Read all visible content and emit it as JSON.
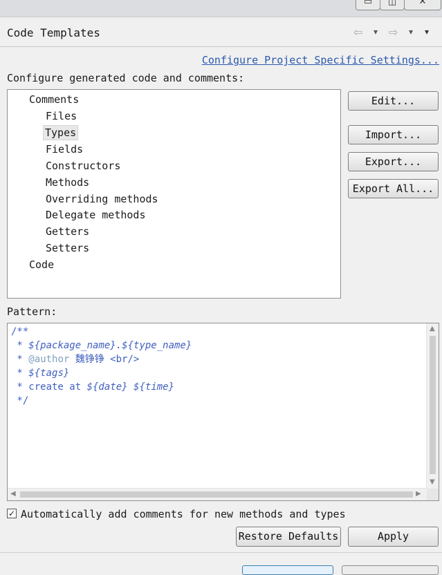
{
  "window": {
    "minimize": "▭",
    "maximize": "◫",
    "close": "✕"
  },
  "header": {
    "title": "Code Templates",
    "back_icon": "arrow-left-icon",
    "forward_icon": "arrow-right-icon",
    "menu_icon": "chevron-down-icon"
  },
  "link": "Configure Project Specific Settings...",
  "tree_label": "Configure generated code and comments:",
  "tree": {
    "items": [
      {
        "label": "Comments",
        "level": 0
      },
      {
        "label": "Files",
        "level": 1
      },
      {
        "label": "Types",
        "level": 1,
        "selected": true
      },
      {
        "label": "Fields",
        "level": 1
      },
      {
        "label": "Constructors",
        "level": 1
      },
      {
        "label": "Methods",
        "level": 1
      },
      {
        "label": "Overriding methods",
        "level": 1
      },
      {
        "label": "Delegate methods",
        "level": 1
      },
      {
        "label": "Getters",
        "level": 1
      },
      {
        "label": "Setters",
        "level": 1
      },
      {
        "label": "Code",
        "level": 0
      }
    ]
  },
  "buttons": {
    "edit": "Edit...",
    "import": "Import...",
    "export": "Export...",
    "export_all": "Export All...",
    "restore_defaults": "Restore Defaults",
    "apply": "Apply"
  },
  "pattern_label": "Pattern:",
  "pattern": {
    "line1": "/**",
    "line2_prefix": " * ",
    "line2": "${package_name}.${type_name}",
    "line3_prefix": " * ",
    "line3_tag": "@author",
    "line3": " 魏铮铮 <br/>",
    "line4_prefix": " * ",
    "line4": "${tags}",
    "line5_prefix": " * create at ",
    "line5_date": "${date}",
    "line5_time": "${time}",
    "line6": " */"
  },
  "checkbox": {
    "checked": true,
    "label": "Automatically add comments for new methods and types"
  },
  "colors": {
    "link": "#2a58ad",
    "code": "#3f5fbf",
    "javadoc_tag": "#7f9fbf"
  }
}
